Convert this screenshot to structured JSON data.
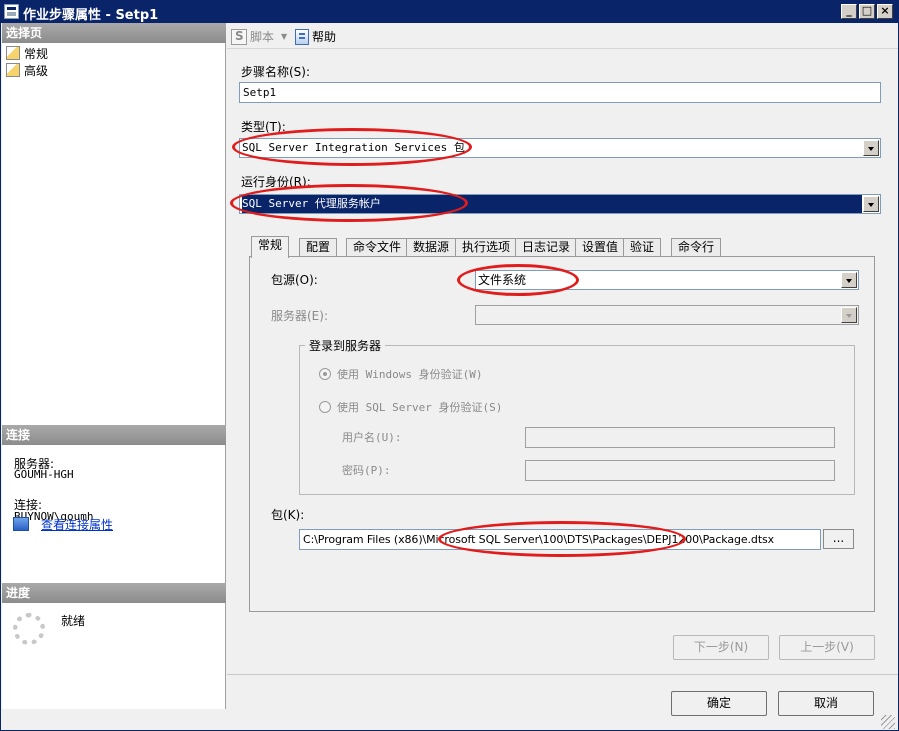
{
  "window": {
    "title": "作业步骤属性 - Setp1"
  },
  "titlebar_buttons": {
    "minimize": "_",
    "maximize": "□",
    "close": "×"
  },
  "left": {
    "select_page_header": "选择页",
    "pages": [
      {
        "label": "常规",
        "icon": "page-settings-icon"
      },
      {
        "label": "高级",
        "icon": "page-settings-icon"
      }
    ],
    "connection_header": "连接",
    "server_label": "服务器:",
    "server_value": "GOUMH-HGH",
    "connection_label": "连接:",
    "connection_value": "BUYNOW\\goumh",
    "view_connection_link": "查看连接属性",
    "progress_header": "进度",
    "progress_status": "就绪"
  },
  "toolbar": {
    "script_label": "脚本",
    "help_label": "帮助"
  },
  "form": {
    "step_name_label": "步骤名称(S):",
    "step_name_value": "Setp1",
    "type_label": "类型(T):",
    "type_value": "SQL Server Integration Services 包",
    "run_as_label": "运行身份(R):",
    "run_as_value": "SQL Server 代理服务帐户"
  },
  "tabs": [
    "常规",
    "配置",
    "命令文件",
    "数据源",
    "执行选项",
    "日志记录",
    "设置值",
    "验证",
    "命令行"
  ],
  "general": {
    "package_source_label": "包源(O):",
    "package_source_value": "文件系统",
    "server_label": "服务器(E):",
    "login_group_label": "登录到服务器",
    "windows_auth_label": "使用 Windows 身份验证(W)",
    "sql_auth_label": "使用 SQL Server 身份验证(S)",
    "username_label": "用户名(U):",
    "password_label": "密码(P):",
    "package_label": "包(K):",
    "package_path": "C:\\Program Files (x86)\\Microsoft SQL Server\\100\\DTS\\Packages\\DEPJ1200\\Package.dtsx",
    "browse_label": "..."
  },
  "buttons": {
    "next": "下一步(N)",
    "prev": "上一步(V)",
    "ok": "确定",
    "cancel": "取消"
  },
  "colors": {
    "titlebar": "#0a246a",
    "selection": "#0a246a",
    "annotation": "#e11c1c",
    "link": "#0033cc"
  }
}
